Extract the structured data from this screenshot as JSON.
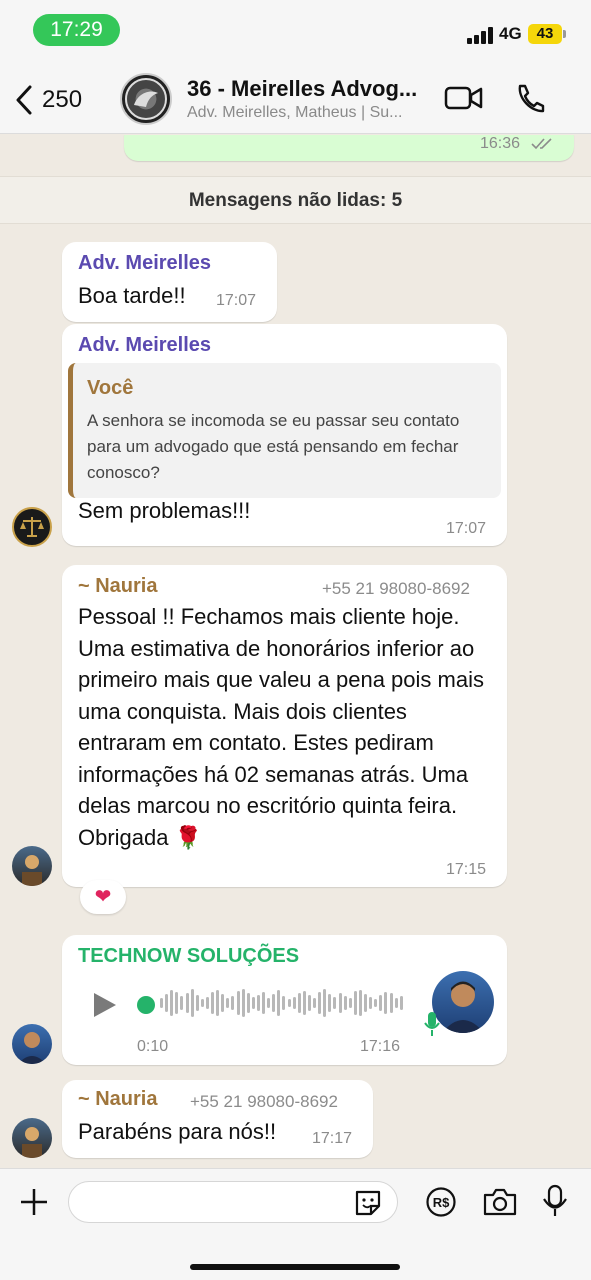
{
  "status_bar": {
    "time": "17:29",
    "network": "4G",
    "battery": "43"
  },
  "header": {
    "back_count": "250",
    "title": "36 - Meirelles Advog...",
    "subtitle": "Adv. Meirelles, Matheus | Su..."
  },
  "chat": {
    "prev_time": "16:36",
    "unread_banner": "Mensagens não lidas: 5",
    "messages": [
      {
        "sender": "Adv. Meirelles",
        "text": "Boa tarde!!",
        "time": "17:07"
      },
      {
        "sender": "Adv. Meirelles",
        "quote_sender": "Você",
        "quote_text": "A senhora se incomoda se eu passar seu contato para um advogado que está pensando em fechar conosco?",
        "text": "Sem problemas!!!",
        "time": "17:07"
      },
      {
        "sender": "~ Nauria",
        "phone": "+55 21 98080-8692",
        "text": "Pessoal !! Fechamos mais cliente hoje. Uma estimativa de honorários inferior ao primeiro mais que valeu a pena pois mais uma conquista. Mais dois clientes entraram em contato. Estes pediram informações há 02 semanas atrás.  Uma delas marcou no escritório quinta feira.  Obrigada 🌹",
        "time": "17:15",
        "reaction": "❤"
      },
      {
        "sender": "TECHNOW SOLUÇÕES",
        "voice_duration": "0:10",
        "time": "17:16"
      },
      {
        "sender": "~ Nauria",
        "phone": "+55 21 98080-8692",
        "text": "Parabéns para nós!!",
        "time": "17:17"
      }
    ]
  },
  "colors": {
    "meirelles_name": "#5b4ab0",
    "nauria_name": "#a0763c",
    "technow_name": "#25b36a",
    "outgoing_bubble": "#d9fdd3",
    "chat_background": "#efeae2"
  },
  "icons": [
    "back-chevron-icon",
    "video-call-icon",
    "phone-icon",
    "read-receipt-icon",
    "play-icon",
    "mic-icon",
    "plus-icon",
    "sticker-icon",
    "pix-icon",
    "camera-icon",
    "microphone-icon"
  ]
}
